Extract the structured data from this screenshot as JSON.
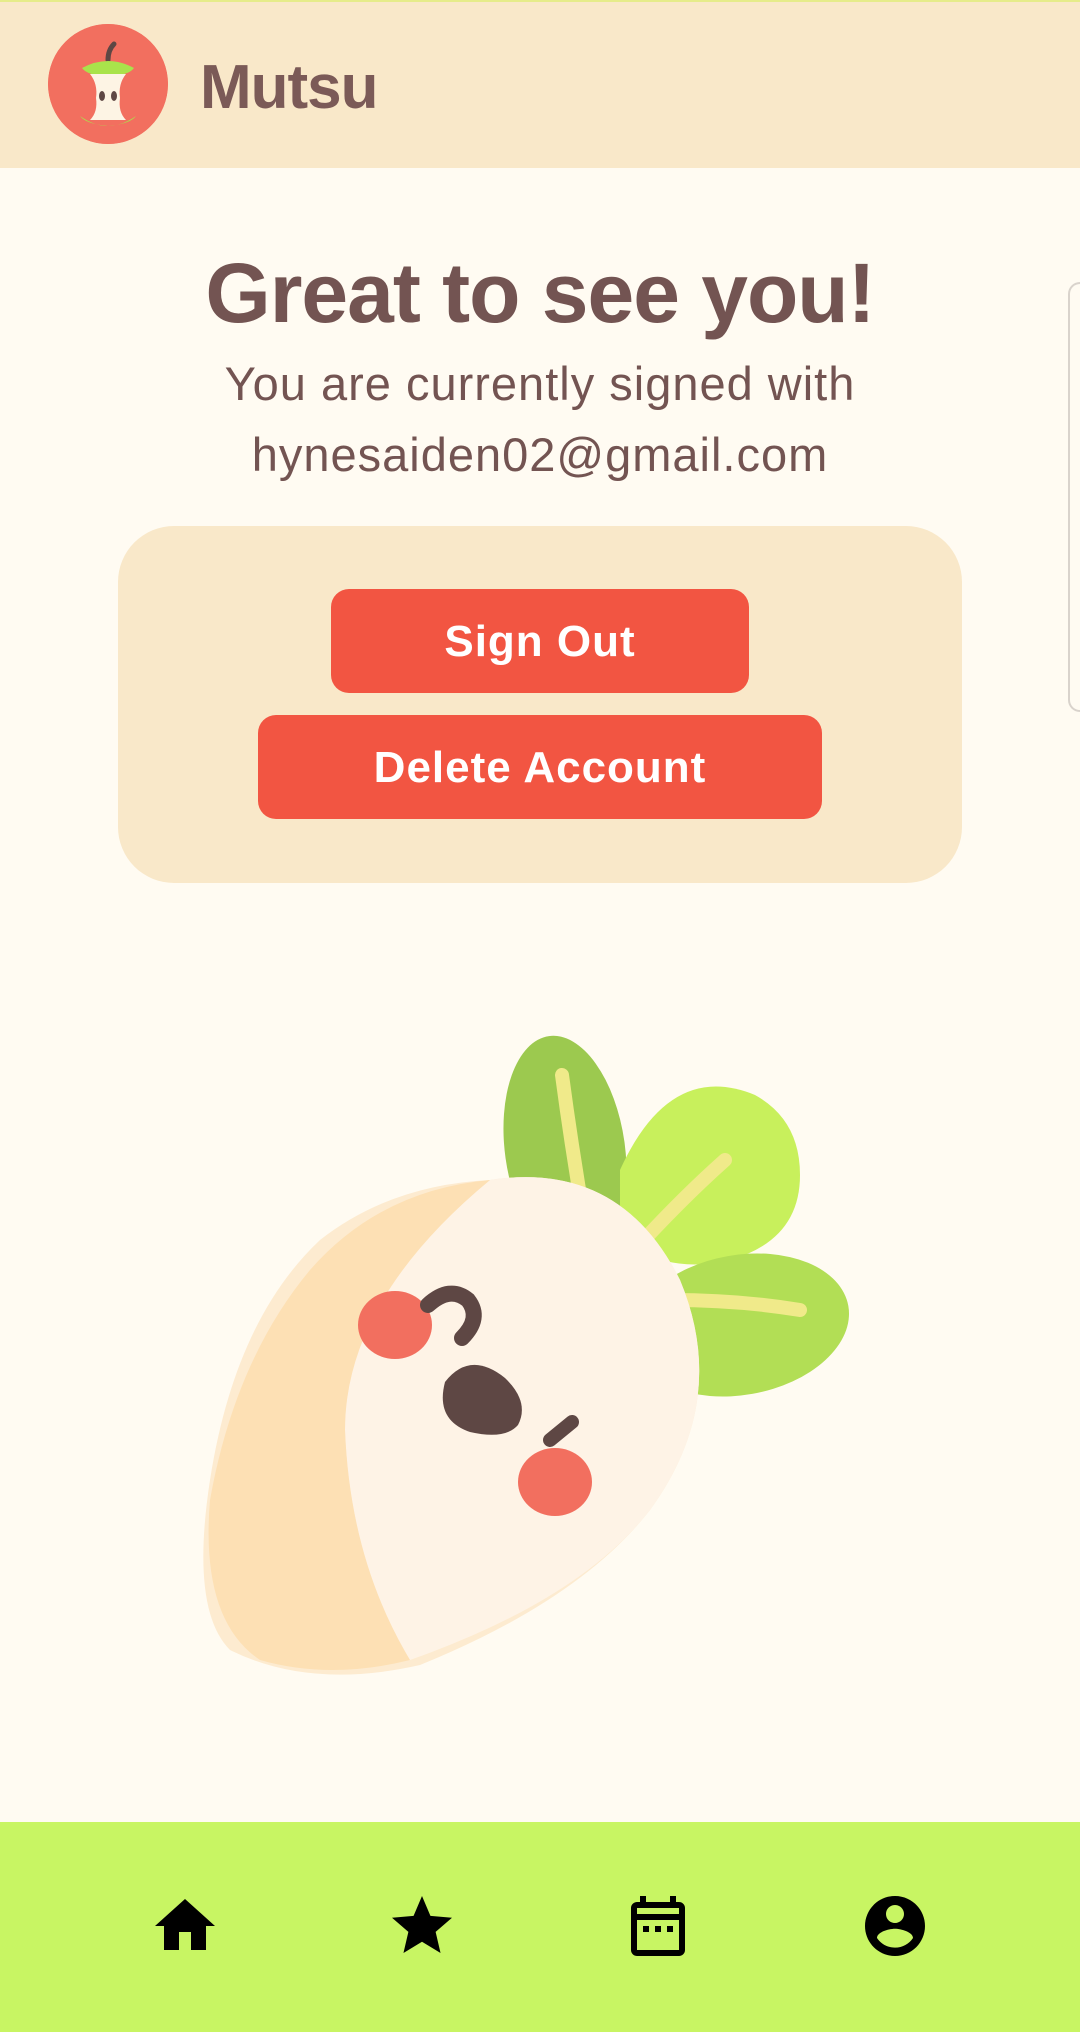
{
  "app": {
    "title": "Mutsu",
    "logo_icon": "apple-core-icon"
  },
  "main": {
    "greeting": "Great to see you!",
    "signed_line": "You are currently signed with",
    "email": "hynesaiden02@gmail.com"
  },
  "actions": {
    "sign_out_label": "Sign Out",
    "delete_account_label": "Delete Account"
  },
  "illustration": {
    "icon": "radish-mascot-icon"
  },
  "bottom_nav": {
    "items": [
      {
        "icon": "home-icon"
      },
      {
        "icon": "star-icon"
      },
      {
        "icon": "calendar-icon"
      },
      {
        "icon": "account-circle-icon"
      }
    ]
  },
  "colors": {
    "app_bar": "#f9e8c9",
    "background": "#fffbf2",
    "text": "#735452",
    "button": "#f25542",
    "bottom_nav": "#c8f563"
  }
}
